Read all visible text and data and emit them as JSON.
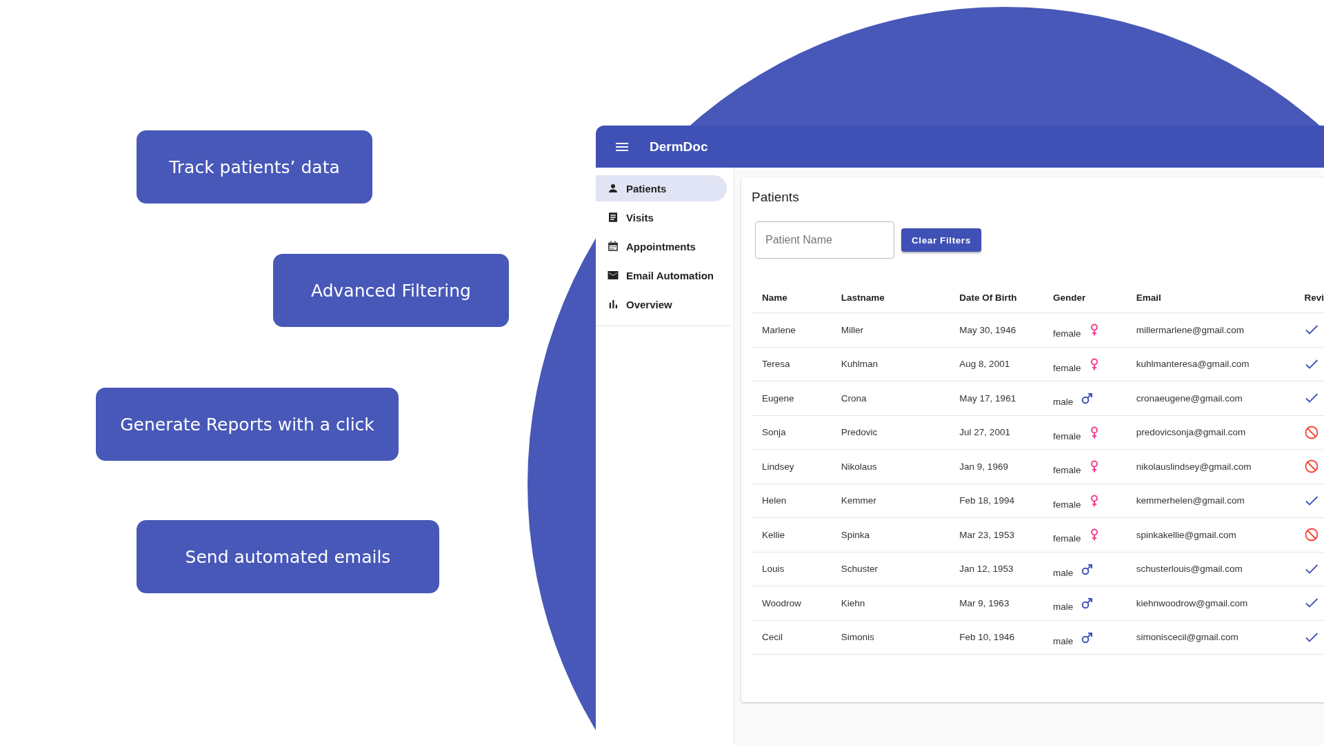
{
  "features": [
    {
      "label": "Track patients’ data"
    },
    {
      "label": "Advanced Filtering"
    },
    {
      "label": "Generate Reports with a click"
    },
    {
      "label": "Send automated emails"
    }
  ],
  "app": {
    "title": "DermDoc",
    "nav": [
      {
        "label": "Patients",
        "selected": true
      },
      {
        "label": "Visits",
        "selected": false
      },
      {
        "label": "Appointments",
        "selected": false
      },
      {
        "label": "Email Automation",
        "selected": false
      },
      {
        "label": "Overview",
        "selected": false
      }
    ],
    "page_title": "Patients",
    "filter": {
      "placeholder": "Patient Name"
    },
    "clear_button": "Clear Filters",
    "table": {
      "columns": [
        "Name",
        "Lastname",
        "Date Of Birth",
        "Gender",
        "Email",
        "Revi"
      ],
      "rows": [
        {
          "name": "Marlene",
          "lastname": "Miller",
          "dob": "May 30, 1946",
          "gender": "female",
          "kind": "female",
          "email": "millermarlene@gmail.com",
          "reviewed": true
        },
        {
          "name": "Teresa",
          "lastname": "Kuhlman",
          "dob": "Aug 8, 2001",
          "gender": "female",
          "kind": "female",
          "email": "kuhlmanteresa@gmail.com",
          "reviewed": true
        },
        {
          "name": "Eugene",
          "lastname": "Crona",
          "dob": "May 17, 1961",
          "gender": "male",
          "kind": "male",
          "email": "cronaeugene@gmail.com",
          "reviewed": true
        },
        {
          "name": "Sonja",
          "lastname": "Predovic",
          "dob": "Jul 27, 2001",
          "gender": "female",
          "kind": "female",
          "email": "predovicsonja@gmail.com",
          "reviewed": false
        },
        {
          "name": "Lindsey",
          "lastname": "Nikolaus",
          "dob": "Jan 9, 1969",
          "gender": "female",
          "kind": "female",
          "email": "nikolauslindsey@gmail.com",
          "reviewed": false
        },
        {
          "name": "Helen",
          "lastname": "Kemmer",
          "dob": "Feb 18, 1994",
          "gender": "female",
          "kind": "female",
          "email": "kemmerhelen@gmail.com",
          "reviewed": true
        },
        {
          "name": "Kellie",
          "lastname": "Spinka",
          "dob": "Mar 23, 1953",
          "gender": "female",
          "kind": "female",
          "email": "spinkakellie@gmail.com",
          "reviewed": false
        },
        {
          "name": "Louis",
          "lastname": "Schuster",
          "dob": "Jan 12, 1953",
          "gender": "male",
          "kind": "male",
          "email": "schusterlouis@gmail.com",
          "reviewed": true
        },
        {
          "name": "Woodrow",
          "lastname": "Kiehn",
          "dob": "Mar 9, 1963",
          "gender": "male",
          "kind": "male",
          "email": "kiehnwoodrow@gmail.com",
          "reviewed": true
        },
        {
          "name": "Cecil",
          "lastname": "Simonis",
          "dob": "Feb 10, 1946",
          "gender": "male",
          "kind": "male",
          "email": "simoniscecil@gmail.com",
          "reviewed": true
        }
      ]
    }
  }
}
